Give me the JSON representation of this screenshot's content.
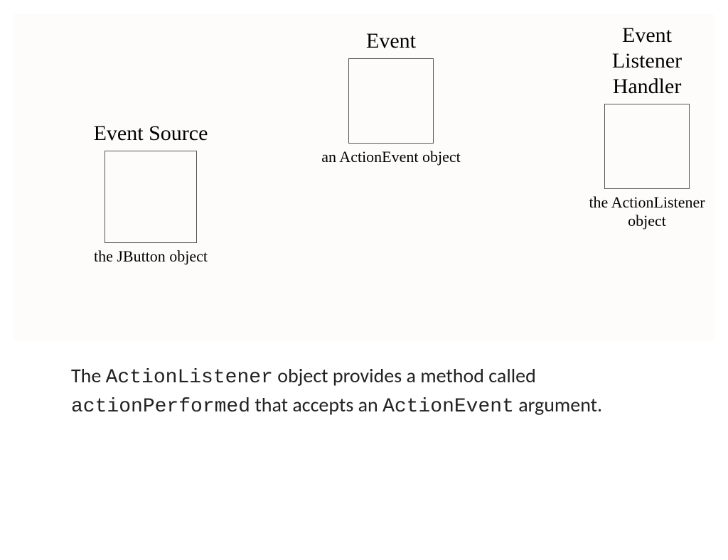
{
  "diagram": {
    "eventSource": {
      "title": "Event Source",
      "caption": "the JButton object"
    },
    "event": {
      "title": "Event",
      "caption": "an ActionEvent object"
    },
    "handler": {
      "titleLine1": "Event",
      "titleLine2": "Listener",
      "titleLine3": "Handler",
      "caption": "the ActionListener object"
    }
  },
  "description": {
    "t1": "The ",
    "c1": "ActionListener",
    "t2": " object provides a method called ",
    "c2": "actionPerformed",
    "t3": " that accepts an ",
    "c3": "ActionEvent",
    "t4": " argument."
  }
}
